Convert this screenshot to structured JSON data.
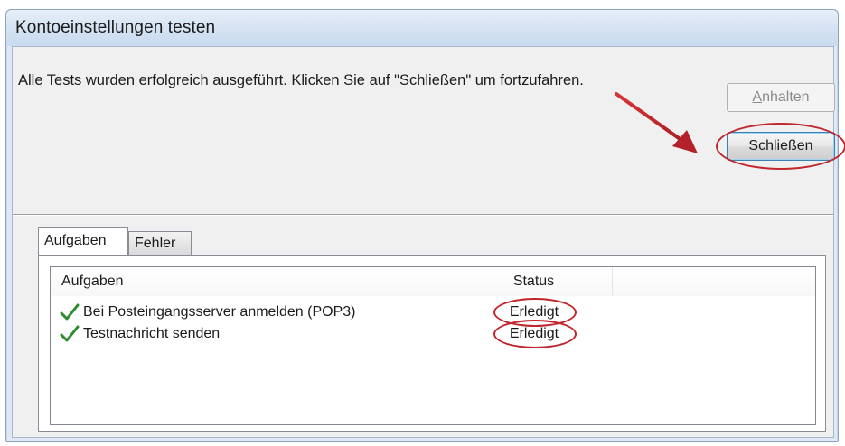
{
  "window": {
    "title": "Kontoeinstellungen testen"
  },
  "message": "Alle Tests wurden erfolgreich ausgeführt. Klicken Sie auf \"Schließen\" um fortzufahren.",
  "buttons": {
    "stop_label_prefix": "",
    "stop_label_mnemonic": "A",
    "stop_label_rest": "nhalten",
    "stop_enabled": false,
    "close_label": "Schließen",
    "close_default": true
  },
  "tabs": [
    {
      "label": "Aufgaben",
      "selected": true
    },
    {
      "label": "Fehler",
      "selected": false
    }
  ],
  "table": {
    "columns": [
      "Aufgaben",
      "Status"
    ],
    "rows": [
      {
        "task": "Bei Posteingangsserver anmelden (POP3)",
        "status": "Erledigt",
        "icon": "checkmark-icon"
      },
      {
        "task": "Testnachricht senden",
        "status": "Erledigt",
        "icon": "checkmark-icon"
      }
    ]
  },
  "colors": {
    "highlight_annotation": "#c0262c",
    "checkmark": "#2e8b2e",
    "default_button_border": "#3c7fb1"
  },
  "annotations": {
    "arrow_icon": "red-arrow-icon",
    "circle_icon": "red-circle-highlight"
  }
}
